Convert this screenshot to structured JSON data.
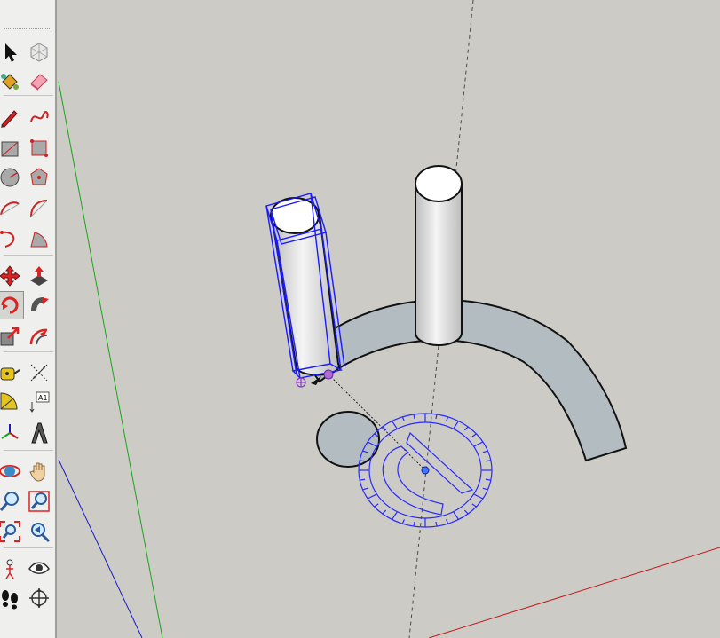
{
  "app": "SketchUp",
  "toolbar": {
    "tools": [
      {
        "name": "select-tool",
        "icon": "arrow-cursor-icon"
      },
      {
        "name": "make-component-tool",
        "icon": "component-cube-icon"
      },
      {
        "name": "paint-bucket-tool",
        "icon": "paint-bucket-icon"
      },
      {
        "name": "eraser-tool",
        "icon": "eraser-icon"
      },
      {
        "name": "line-tool",
        "icon": "pencil-icon"
      },
      {
        "name": "freehand-tool",
        "icon": "freehand-curve-icon"
      },
      {
        "name": "rectangle-tool",
        "icon": "rectangle-icon"
      },
      {
        "name": "rotated-rectangle-tool",
        "icon": "rotated-rectangle-icon"
      },
      {
        "name": "circle-tool",
        "icon": "circle-icon"
      },
      {
        "name": "polygon-tool",
        "icon": "polygon-icon"
      },
      {
        "name": "arc-tool",
        "icon": "arc-icon"
      },
      {
        "name": "two-point-arc-tool",
        "icon": "two-point-arc-icon"
      },
      {
        "name": "three-point-arc-tool",
        "icon": "three-point-arc-icon"
      },
      {
        "name": "pie-tool",
        "icon": "pie-icon"
      },
      {
        "name": "move-tool",
        "icon": "move-arrows-icon"
      },
      {
        "name": "push-pull-tool",
        "icon": "push-pull-icon"
      },
      {
        "name": "rotate-tool",
        "icon": "rotate-icon",
        "active": true
      },
      {
        "name": "follow-me-tool",
        "icon": "follow-me-icon"
      },
      {
        "name": "scale-tool",
        "icon": "scale-icon"
      },
      {
        "name": "offset-tool",
        "icon": "offset-icon"
      },
      {
        "name": "tape-measure-tool",
        "icon": "tape-measure-icon"
      },
      {
        "name": "dimension-tool",
        "icon": "dimension-icon"
      },
      {
        "name": "protractor-tool",
        "icon": "protractor-icon"
      },
      {
        "name": "text-tool",
        "icon": "text-label-icon",
        "label": "A1"
      },
      {
        "name": "axes-tool",
        "icon": "axes-icon"
      },
      {
        "name": "3d-text-tool",
        "icon": "3d-text-icon"
      },
      {
        "name": "orbit-tool",
        "icon": "orbit-icon"
      },
      {
        "name": "pan-tool",
        "icon": "pan-hand-icon"
      },
      {
        "name": "zoom-tool",
        "icon": "zoom-magnifier-icon"
      },
      {
        "name": "zoom-window-tool",
        "icon": "zoom-window-icon"
      },
      {
        "name": "zoom-extents-tool",
        "icon": "zoom-extents-icon"
      },
      {
        "name": "previous-view-tool",
        "icon": "previous-view-icon"
      },
      {
        "name": "position-camera-tool",
        "icon": "position-camera-icon"
      },
      {
        "name": "look-around-tool",
        "icon": "eye-icon"
      },
      {
        "name": "walk-tool",
        "icon": "footprints-icon"
      },
      {
        "name": "section-plane-tool",
        "icon": "section-plane-icon"
      }
    ]
  },
  "viewport": {
    "background": "#cccbc6",
    "axis_colors": {
      "red": "#c21a1a",
      "green": "#1ba51b",
      "blue": "#1b1bc4"
    },
    "selection_color": "#1a1aff",
    "face_colors": {
      "surface": "#b3bcc1",
      "top": "#ffffff",
      "cylinder": "#e2e2e2"
    }
  }
}
